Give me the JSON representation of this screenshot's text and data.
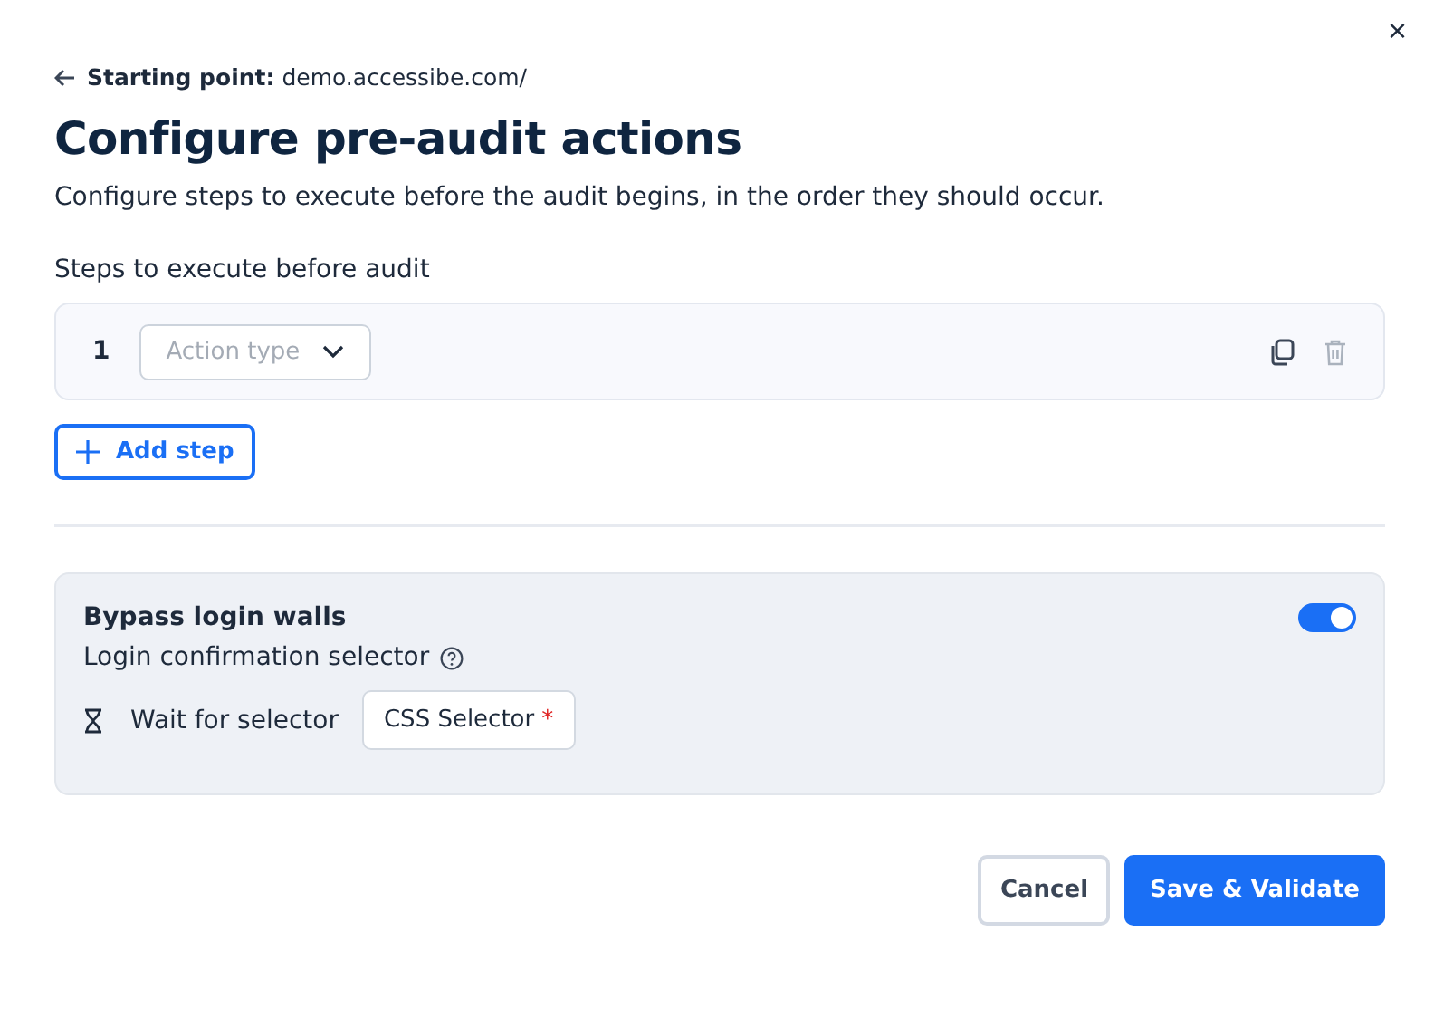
{
  "close_button": {
    "label": "×"
  },
  "starting_point": "**Starting point:** demo.accessibe.com/",
  "title": "Configure pre-audit actions",
  "description": "Configure steps to execute before the audit begins, in the order they should occur.",
  "steps_label": "Steps to execute before audit",
  "steps": [
    {
      "number": "1",
      "placeholder": "Action type",
      "delete_disabled": true
    }
  ],
  "add_step": "Add step",
  "bypass": {
    "title": "Bypass login walls",
    "on": true,
    "subtitle": "Login confirmation selector",
    "wait_label": "Wait for selector",
    "selector": {
      "placeholder": "CSS Selector",
      "required_mark": "*"
    }
  },
  "buttons": [
    "Cancel",
    "Save & Validate"
  ]
}
